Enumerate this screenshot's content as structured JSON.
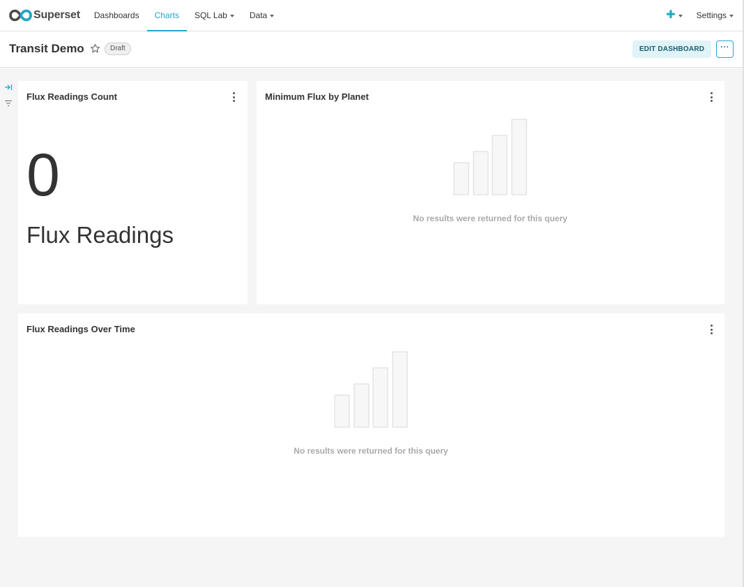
{
  "app": {
    "brand": "Superset"
  },
  "nav": {
    "items": [
      {
        "label": "Dashboards",
        "active": false,
        "dropdown": false
      },
      {
        "label": "Charts",
        "active": true,
        "dropdown": false
      },
      {
        "label": "SQL Lab",
        "active": false,
        "dropdown": true
      },
      {
        "label": "Data",
        "active": false,
        "dropdown": true
      }
    ],
    "settings_label": "Settings"
  },
  "dashboard": {
    "title": "Transit Demo",
    "status_badge": "Draft",
    "edit_label": "EDIT DASHBOARD",
    "more_label": "···"
  },
  "charts": [
    {
      "title": "Flux Readings Count",
      "big_number": "0",
      "subheader": "Flux Readings"
    },
    {
      "title": "Minimum Flux by Planet",
      "empty_message": "No results were returned for this query"
    },
    {
      "title": "Flux Readings Over Time",
      "empty_message": "No results were returned for this query"
    }
  ],
  "colors": {
    "accent": "#20a7c9",
    "background": "#f5f5f5",
    "edit_button_bg": "#e0f3f7",
    "empty_text": "#aaaaaa"
  }
}
